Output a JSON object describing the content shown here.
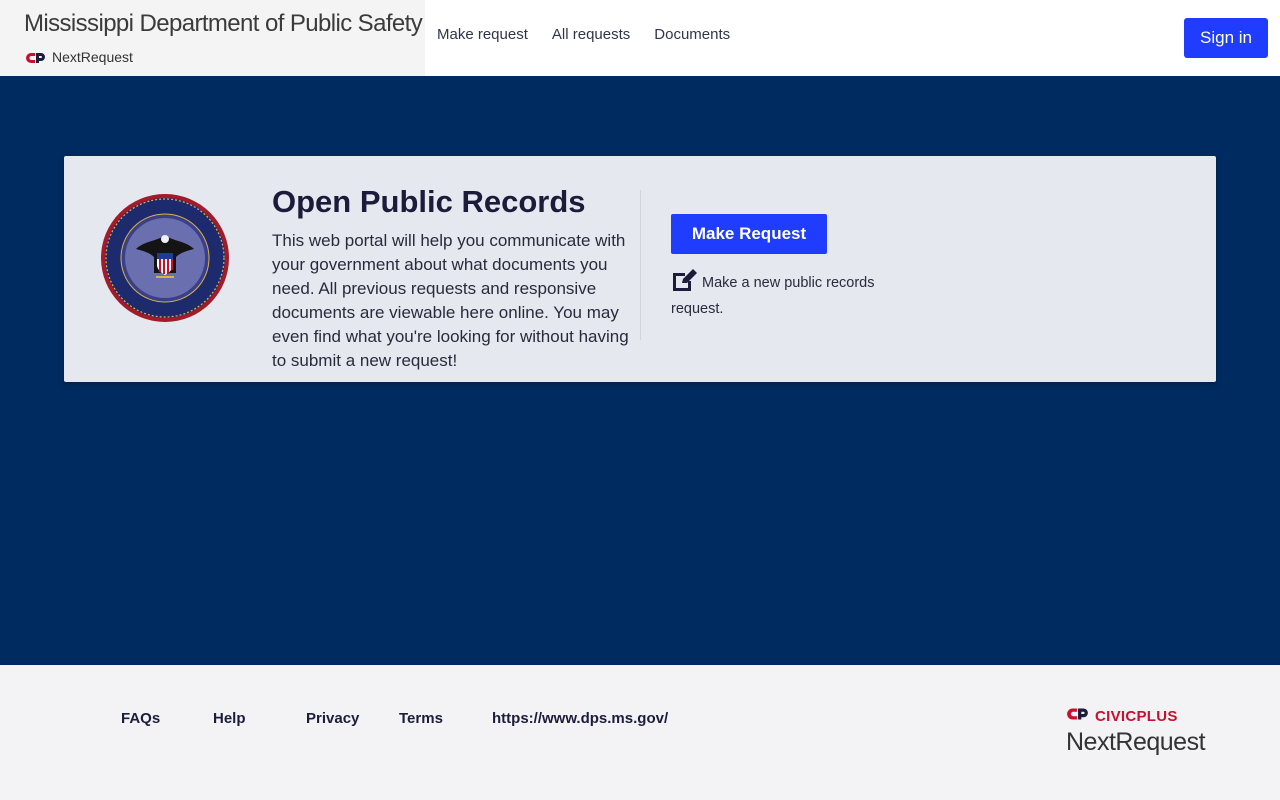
{
  "header": {
    "org_title": "Mississippi Department of Public Safety",
    "brand_sub": "NextRequest",
    "nav": [
      {
        "label": "Make request"
      },
      {
        "label": "All requests"
      },
      {
        "label": "Documents"
      }
    ],
    "signin_label": "Sign in"
  },
  "hero": {
    "title": "Open Public Records",
    "description": "This web portal will help you communicate with your government about what documents you need. All previous requests and responsive documents are viewable here online. You may even find what you're looking for without having to submit a new request!",
    "make_request_label": "Make Request",
    "make_request_hint": "Make a new public records request.",
    "seal_icon": "mississippi-dps-seal"
  },
  "footer": {
    "links": [
      {
        "label": "FAQs"
      },
      {
        "label": "Help"
      },
      {
        "label": "Privacy"
      },
      {
        "label": "Terms"
      },
      {
        "label": "https://www.dps.ms.gov/"
      }
    ],
    "civic_brand": "CIVICPLUS",
    "product_name": "NextRequest"
  },
  "colors": {
    "accent": "#1f3cff",
    "hero_bg": "#002b60",
    "card_bg": "#e5e8ef",
    "brand_red": "#c8102e"
  }
}
